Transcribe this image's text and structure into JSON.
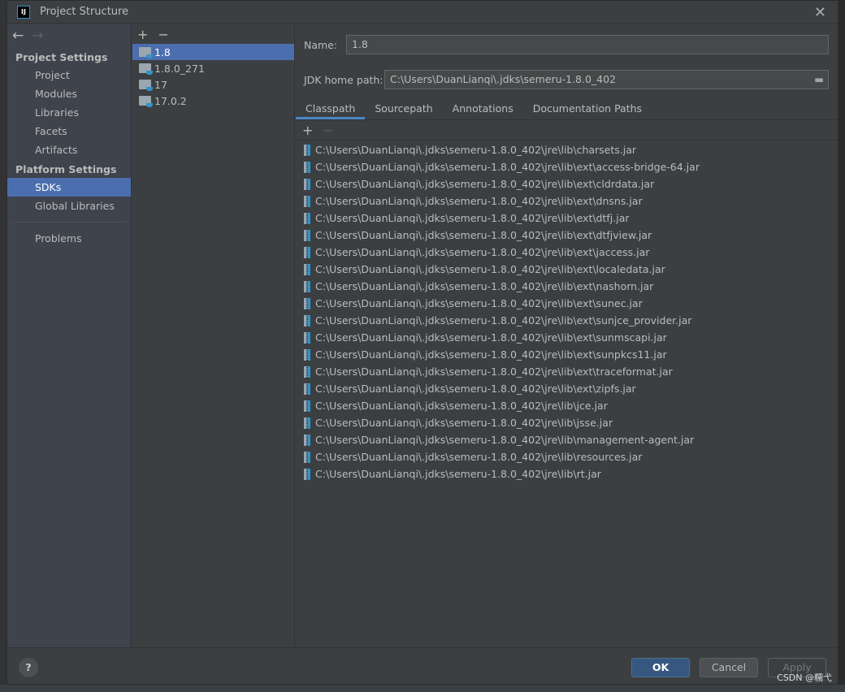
{
  "window": {
    "title": "Project Structure",
    "logo": "IJ"
  },
  "sidebar": {
    "project_settings": "Project Settings",
    "project_items": [
      "Project",
      "Modules",
      "Libraries",
      "Facets",
      "Artifacts"
    ],
    "platform_settings": "Platform Settings",
    "platform_items": [
      "SDKs",
      "Global Libraries"
    ],
    "problems": "Problems",
    "selected": "SDKs"
  },
  "sdks": {
    "items": [
      "1.8",
      "1.8.0_271",
      "17",
      "17.0.2"
    ],
    "selected": "1.8"
  },
  "detail": {
    "name_label": "Name:",
    "name_value": "1.8",
    "home_label": "JDK home path:",
    "home_value": "C:\\Users\\DuanLianqi\\.jdks\\semeru-1.8.0_402",
    "tabs": [
      "Classpath",
      "Sourcepath",
      "Annotations",
      "Documentation Paths"
    ],
    "selected_tab": "Classpath",
    "classpath": [
      "C:\\Users\\DuanLianqi\\.jdks\\semeru-1.8.0_402\\jre\\lib\\charsets.jar",
      "C:\\Users\\DuanLianqi\\.jdks\\semeru-1.8.0_402\\jre\\lib\\ext\\access-bridge-64.jar",
      "C:\\Users\\DuanLianqi\\.jdks\\semeru-1.8.0_402\\jre\\lib\\ext\\cldrdata.jar",
      "C:\\Users\\DuanLianqi\\.jdks\\semeru-1.8.0_402\\jre\\lib\\ext\\dnsns.jar",
      "C:\\Users\\DuanLianqi\\.jdks\\semeru-1.8.0_402\\jre\\lib\\ext\\dtfj.jar",
      "C:\\Users\\DuanLianqi\\.jdks\\semeru-1.8.0_402\\jre\\lib\\ext\\dtfjview.jar",
      "C:\\Users\\DuanLianqi\\.jdks\\semeru-1.8.0_402\\jre\\lib\\ext\\jaccess.jar",
      "C:\\Users\\DuanLianqi\\.jdks\\semeru-1.8.0_402\\jre\\lib\\ext\\localedata.jar",
      "C:\\Users\\DuanLianqi\\.jdks\\semeru-1.8.0_402\\jre\\lib\\ext\\nashorn.jar",
      "C:\\Users\\DuanLianqi\\.jdks\\semeru-1.8.0_402\\jre\\lib\\ext\\sunec.jar",
      "C:\\Users\\DuanLianqi\\.jdks\\semeru-1.8.0_402\\jre\\lib\\ext\\sunjce_provider.jar",
      "C:\\Users\\DuanLianqi\\.jdks\\semeru-1.8.0_402\\jre\\lib\\ext\\sunmscapi.jar",
      "C:\\Users\\DuanLianqi\\.jdks\\semeru-1.8.0_402\\jre\\lib\\ext\\sunpkcs11.jar",
      "C:\\Users\\DuanLianqi\\.jdks\\semeru-1.8.0_402\\jre\\lib\\ext\\traceformat.jar",
      "C:\\Users\\DuanLianqi\\.jdks\\semeru-1.8.0_402\\jre\\lib\\ext\\zipfs.jar",
      "C:\\Users\\DuanLianqi\\.jdks\\semeru-1.8.0_402\\jre\\lib\\jce.jar",
      "C:\\Users\\DuanLianqi\\.jdks\\semeru-1.8.0_402\\jre\\lib\\jsse.jar",
      "C:\\Users\\DuanLianqi\\.jdks\\semeru-1.8.0_402\\jre\\lib\\management-agent.jar",
      "C:\\Users\\DuanLianqi\\.jdks\\semeru-1.8.0_402\\jre\\lib\\resources.jar",
      "C:\\Users\\DuanLianqi\\.jdks\\semeru-1.8.0_402\\jre\\lib\\rt.jar"
    ]
  },
  "footer": {
    "help": "?",
    "ok": "OK",
    "cancel": "Cancel",
    "apply": "Apply"
  },
  "watermark": "CSDN @糯弋",
  "colors": {
    "selection": "#4b6eaf",
    "ok_button": "#365880",
    "tab_underline": "#4a88c7"
  }
}
